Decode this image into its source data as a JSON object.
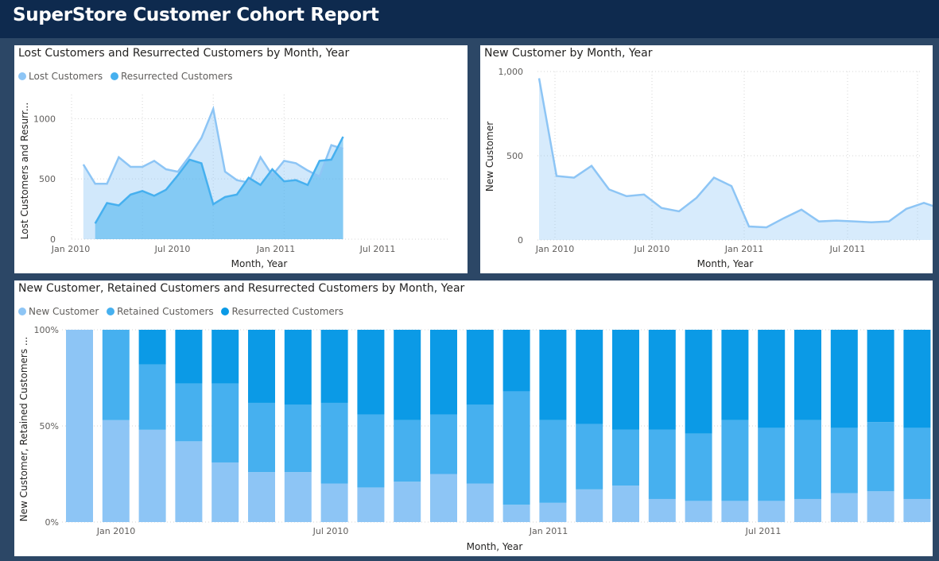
{
  "app": {
    "title": "SuperStore Customer Cohort Report"
  },
  "colors": {
    "light": "#8dc5f5",
    "mid": "#46b0ef",
    "dark": "#0b9ae6"
  },
  "chart_data": [
    {
      "id": "lost-resurrected",
      "type": "area",
      "title": "Lost Customers and Resurrected Customers by Month, Year",
      "xlabel": "Month, Year",
      "ylabel": "Lost Customers and Resurr...",
      "x_ticks": [
        "Jan 2010",
        "Jul 2010",
        "Jan 2011",
        "Jul 2011"
      ],
      "y_ticks": [
        "0",
        "500",
        "1000"
      ],
      "ylim": [
        0,
        1200
      ],
      "grid": true,
      "legend_position": "top-left",
      "series": [
        {
          "name": "Lost Customers",
          "color": "#8dc5f5",
          "values": [
            620,
            460,
            460,
            680,
            600,
            600,
            650,
            580,
            560,
            690,
            840,
            1080,
            560,
            490,
            470,
            680,
            530,
            650,
            630,
            570,
            520,
            780,
            750
          ]
        },
        {
          "name": "Resurrected Customers",
          "color": "#46b0ef",
          "values": [
            null,
            130,
            300,
            280,
            370,
            400,
            360,
            410,
            530,
            660,
            630,
            290,
            350,
            370,
            510,
            450,
            580,
            480,
            490,
            450,
            650,
            660,
            850
          ]
        }
      ]
    },
    {
      "id": "new-customer",
      "type": "area",
      "title": "New Customer by Month, Year",
      "xlabel": "Month, Year",
      "ylabel": "New Customer",
      "x_ticks": [
        "Jan 2010",
        "Jul 2010",
        "Jan 2011",
        "Jul 2011"
      ],
      "y_ticks": [
        "0",
        "500",
        "1,000"
      ],
      "ylim": [
        0,
        1000
      ],
      "grid": true,
      "series": [
        {
          "name": "New Customer",
          "color": "#8dc5f5",
          "values": [
            960,
            380,
            370,
            440,
            300,
            260,
            270,
            190,
            170,
            250,
            370,
            320,
            80,
            75,
            130,
            180,
            110,
            115,
            110,
            105,
            110,
            185,
            220,
            185
          ]
        }
      ]
    },
    {
      "id": "cohort-stacked",
      "type": "bar",
      "stacking": "percent",
      "title": "New Customer, Retained Customers and Resurrected Customers by Month, Year",
      "xlabel": "Month, Year",
      "ylabel": "New Customer, Retained Customers ...",
      "x_ticks": [
        "Jan 2010",
        "Jul 2010",
        "Jan 2011",
        "Jul 2011"
      ],
      "y_ticks": [
        "0%",
        "50%",
        "100%"
      ],
      "ylim": [
        0,
        100
      ],
      "legend_position": "top-left",
      "series": [
        {
          "name": "New Customer",
          "color": "#8dc5f5",
          "values": [
            100,
            53,
            48,
            42,
            31,
            26,
            26,
            20,
            18,
            21,
            25,
            20,
            9,
            10,
            17,
            19,
            12,
            11,
            11,
            11,
            12,
            15,
            16,
            12
          ]
        },
        {
          "name": "Retained Customers",
          "color": "#46b0ef",
          "values": [
            0,
            47,
            34,
            30,
            41,
            36,
            35,
            42,
            38,
            32,
            31,
            41,
            59,
            43,
            34,
            29,
            36,
            35,
            42,
            38,
            41,
            34,
            36,
            37
          ]
        },
        {
          "name": "Resurrected Customers",
          "color": "#0b9ae6",
          "values": [
            0,
            0,
            18,
            28,
            28,
            38,
            39,
            38,
            44,
            47,
            44,
            39,
            32,
            47,
            49,
            52,
            52,
            54,
            47,
            51,
            47,
            51,
            48,
            51
          ]
        }
      ]
    }
  ]
}
